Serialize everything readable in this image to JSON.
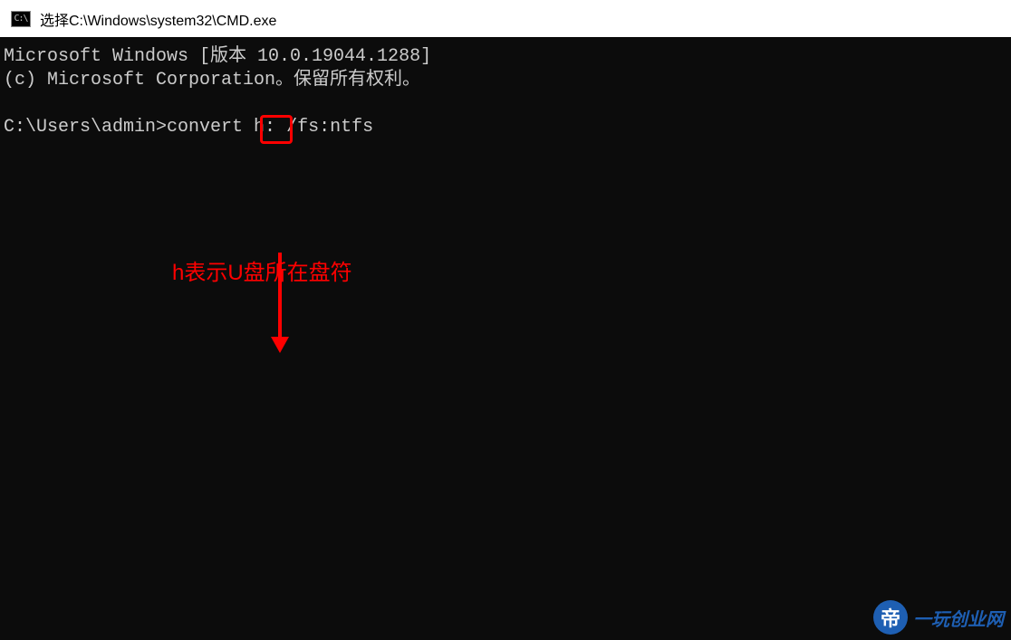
{
  "titlebar": {
    "icon_label": "C:\\",
    "title": "选择C:\\Windows\\system32\\CMD.exe"
  },
  "terminal": {
    "line1": "Microsoft Windows [版本 10.0.19044.1288]",
    "line2": "(c) Microsoft Corporation。保留所有权利。",
    "prompt_prefix": "C:\\Users\\admin>",
    "command_part1": "convert ",
    "command_highlight": "h:",
    "command_part2": " /fs:ntfs"
  },
  "annotation": {
    "text": "h表示U盘所在盘符"
  },
  "watermark": {
    "icon_char": "帝",
    "text": "一玩创业网"
  }
}
